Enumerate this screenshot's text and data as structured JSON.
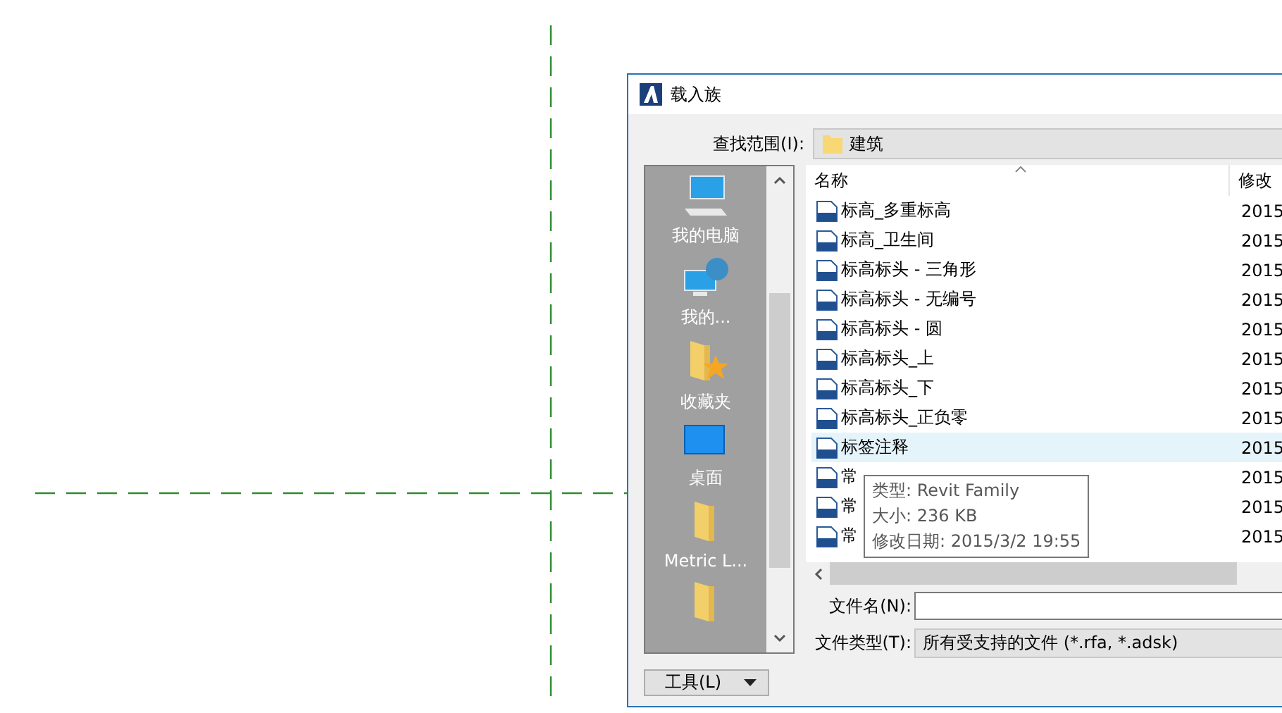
{
  "window": {
    "title": "载入族"
  },
  "look_in": {
    "label": "查找范围(I):",
    "value": "建筑"
  },
  "places": [
    {
      "label": "我的电脑",
      "kind": "computer"
    },
    {
      "label": "我的...",
      "kind": "network"
    },
    {
      "label": "收藏夹",
      "kind": "favorites"
    },
    {
      "label": "桌面",
      "kind": "desktop"
    },
    {
      "label": "Metric L...",
      "kind": "folder"
    },
    {
      "kind": "folder"
    }
  ],
  "file_list": {
    "columns": [
      "名称",
      "修改"
    ],
    "rows": [
      {
        "name": "标高_多重标高",
        "modified": "2015",
        "selected": false
      },
      {
        "name": "标高_卫生间",
        "modified": "2015",
        "selected": false
      },
      {
        "name": "标高标头 - 三角形",
        "modified": "2015",
        "selected": false
      },
      {
        "name": "标高标头 - 无编号",
        "modified": "2015",
        "selected": false
      },
      {
        "name": "标高标头 - 圆",
        "modified": "2015",
        "selected": false
      },
      {
        "name": "标高标头_上",
        "modified": "2015",
        "selected": false
      },
      {
        "name": "标高标头_下",
        "modified": "2015",
        "selected": false
      },
      {
        "name": "标高标头_正负零",
        "modified": "2015",
        "selected": false
      },
      {
        "name": "标签注释",
        "modified": "2015",
        "selected": true
      },
      {
        "name": "常",
        "modified": "2015",
        "selected": false
      },
      {
        "name": "常",
        "modified": "2015",
        "selected": false
      },
      {
        "name": "常",
        "modified": "2015",
        "selected": false
      }
    ]
  },
  "tooltip": {
    "lines": [
      "类型: Revit Family",
      "大小: 236 KB",
      "修改日期: 2015/3/2 19:55"
    ]
  },
  "file_name": {
    "label": "文件名(N):"
  },
  "file_type": {
    "label": "文件类型(T):",
    "value": "所有受支持的文件 (*.rfa, *.adsk)"
  },
  "tools_button": {
    "label": "工具(L)"
  }
}
